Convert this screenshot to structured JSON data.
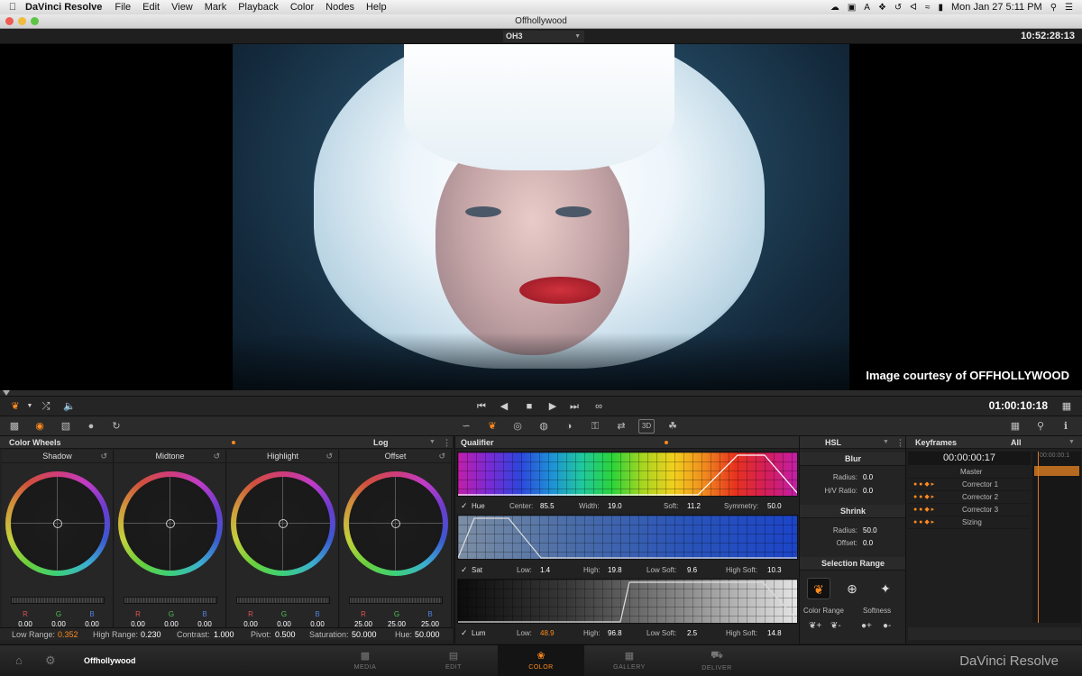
{
  "menubar": {
    "app_name": "DaVinci Resolve",
    "menus": [
      "File",
      "Edit",
      "View",
      "Mark",
      "Playback",
      "Color",
      "Nodes",
      "Help"
    ],
    "clock": "Mon Jan 27  5:11 PM"
  },
  "window": {
    "title": "Offhollywood"
  },
  "viewer": {
    "clip_name": "OH3",
    "source_timecode": "10:52:28:13",
    "courtesy_text": "Image courtesy of OFFHOLLYWOOD"
  },
  "transport": {
    "record_timecode": "01:00:10:18"
  },
  "color_wheels": {
    "title": "Color Wheels",
    "mode": "Log",
    "wheels": [
      {
        "name": "Shadow",
        "r": "0.00",
        "g": "0.00",
        "b": "0.00"
      },
      {
        "name": "Midtone",
        "r": "0.00",
        "g": "0.00",
        "b": "0.00"
      },
      {
        "name": "Highlight",
        "r": "0.00",
        "g": "0.00",
        "b": "0.00"
      },
      {
        "name": "Offset",
        "r": "25.00",
        "g": "25.00",
        "b": "25.00"
      }
    ],
    "channel_labels": {
      "r": "R",
      "g": "G",
      "b": "B"
    },
    "footer": {
      "low_range_label": "Low Range:",
      "low_range": "0.352",
      "high_range_label": "High Range:",
      "high_range": "0.230",
      "contrast_label": "Contrast:",
      "contrast": "1.000",
      "pivot_label": "Pivot:",
      "pivot": "0.500",
      "saturation_label": "Saturation:",
      "saturation": "50.000",
      "hue_label": "Hue:",
      "hue": "50.000"
    }
  },
  "qualifier": {
    "title": "Qualifier",
    "mode": "HSL",
    "hue": {
      "label": "Hue",
      "center_label": "Center:",
      "center": "85.5",
      "width_label": "Width:",
      "width": "19.0",
      "soft_label": "Soft:",
      "soft": "11.2",
      "symmetry_label": "Symmetry:",
      "symmetry": "50.0"
    },
    "sat": {
      "label": "Sat",
      "low_label": "Low:",
      "low": "1.4",
      "high_label": "High:",
      "high": "19.8",
      "low_soft_label": "Low Soft:",
      "low_soft": "9.6",
      "high_soft_label": "High Soft:",
      "high_soft": "10.3"
    },
    "lum": {
      "label": "Lum",
      "low_label": "Low:",
      "low": "48.9",
      "high_label": "High:",
      "high": "96.8",
      "low_soft_label": "Low Soft:",
      "low_soft": "2.5",
      "high_soft_label": "High Soft:",
      "high_soft": "14.8"
    }
  },
  "hsl_panel": {
    "blur_title": "Blur",
    "radius_label": "Radius:",
    "blur_radius": "0.0",
    "hv_ratio_label": "H/V Ratio:",
    "hv_ratio": "0.0",
    "shrink_title": "Shrink",
    "shrink_radius_label": "Radius:",
    "shrink_radius": "50.0",
    "offset_label": "Offset:",
    "offset": "0.0",
    "selection_range_title": "Selection Range",
    "color_range_label": "Color Range",
    "softness_label": "Softness"
  },
  "keyframes": {
    "title": "Keyframes",
    "filter": "All",
    "timecode": "00:00:00:17",
    "track_timecode": "00:00:00:1",
    "items": [
      "Master",
      "Corrector 1",
      "Corrector 2",
      "Corrector 3",
      "Sizing"
    ]
  },
  "pagebar": {
    "project_name": "Offhollywood",
    "pages": [
      "MEDIA",
      "EDIT",
      "COLOR",
      "GALLERY",
      "DELIVER"
    ],
    "active_page": "COLOR",
    "brand": "DaVinci Resolve"
  },
  "colors": {
    "accent": "#ff8a1e",
    "background": "#1b1b1b"
  }
}
